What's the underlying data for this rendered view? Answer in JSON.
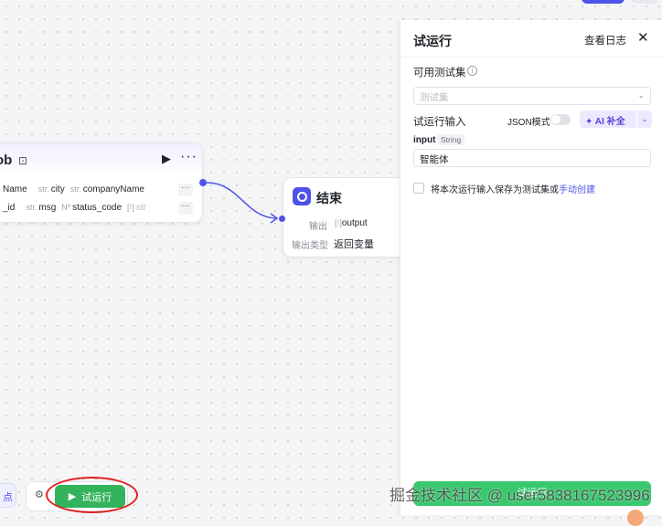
{
  "node": {
    "title": "ob",
    "row1": [
      {
        "type": "",
        "name": "Name"
      },
      {
        "type": "str.",
        "name": "city"
      },
      {
        "type": "str.",
        "name": "companyName"
      }
    ],
    "row2": [
      {
        "type": "",
        "name": "_id"
      },
      {
        "type": "str.",
        "name": "msg"
      },
      {
        "type": "Nº",
        "name": "status_code"
      },
      {
        "type": "[⁝]",
        "name": "str"
      }
    ],
    "more": "···"
  },
  "end_node": {
    "title": "结束",
    "output_label": "输出",
    "output_type_prefix": "[⁝]",
    "output_value": "output",
    "output_kind_label": "输出类型",
    "output_kind_value": "返回变量"
  },
  "panel": {
    "title": "试运行",
    "log_link": "查看日志",
    "testset_label": "可用测试集",
    "testset_placeholder": "测试集",
    "input_section_label": "试运行输入",
    "json_mode_label": "JSON模式",
    "ai_fill_label": "✦ AI 补全",
    "input_name": "input",
    "input_type": "String",
    "input_value": "智能体",
    "save_checkbox_text": "将本次运行输入保存为测试集或",
    "save_checkbox_link": "手动创建",
    "bottom_run_label": "试运行"
  },
  "toolbar": {
    "left_text": "点",
    "run_label": "试运行"
  },
  "watermark": "掘金技术社区 @ user5838167523996",
  "colors": {
    "accent": "#4d53e8",
    "run_green": "#33b35b",
    "highlight_ring": "#e02020"
  }
}
